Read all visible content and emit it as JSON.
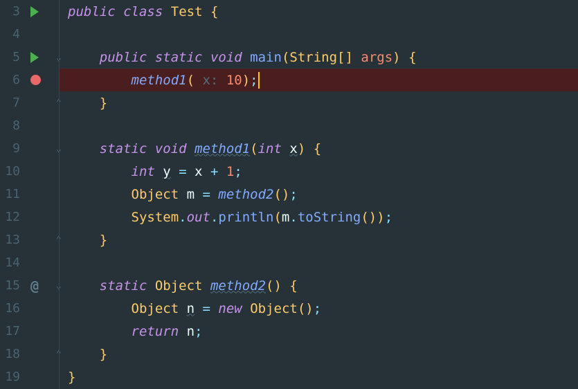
{
  "lines": [
    {
      "num": "3",
      "run": true,
      "breakpoint": false,
      "fold": false,
      "recursive": false,
      "highlighted": false
    },
    {
      "num": "4",
      "run": false,
      "breakpoint": false,
      "fold": false,
      "recursive": false,
      "highlighted": false
    },
    {
      "num": "5",
      "run": true,
      "breakpoint": false,
      "fold": true,
      "recursive": false,
      "highlighted": false
    },
    {
      "num": "6",
      "run": false,
      "breakpoint": true,
      "fold": false,
      "recursive": false,
      "highlighted": true
    },
    {
      "num": "7",
      "run": false,
      "breakpoint": false,
      "fold": true,
      "recursive": false,
      "highlighted": false
    },
    {
      "num": "8",
      "run": false,
      "breakpoint": false,
      "fold": false,
      "recursive": false,
      "highlighted": false
    },
    {
      "num": "9",
      "run": false,
      "breakpoint": false,
      "fold": true,
      "recursive": false,
      "highlighted": false
    },
    {
      "num": "10",
      "run": false,
      "breakpoint": false,
      "fold": false,
      "recursive": false,
      "highlighted": false
    },
    {
      "num": "11",
      "run": false,
      "breakpoint": false,
      "fold": false,
      "recursive": false,
      "highlighted": false
    },
    {
      "num": "12",
      "run": false,
      "breakpoint": false,
      "fold": false,
      "recursive": false,
      "highlighted": false
    },
    {
      "num": "13",
      "run": false,
      "breakpoint": false,
      "fold": true,
      "recursive": false,
      "highlighted": false
    },
    {
      "num": "14",
      "run": false,
      "breakpoint": false,
      "fold": false,
      "recursive": false,
      "highlighted": false
    },
    {
      "num": "15",
      "run": false,
      "breakpoint": false,
      "fold": true,
      "recursive": true,
      "highlighted": false
    },
    {
      "num": "16",
      "run": false,
      "breakpoint": false,
      "fold": false,
      "recursive": false,
      "highlighted": false
    },
    {
      "num": "17",
      "run": false,
      "breakpoint": false,
      "fold": false,
      "recursive": false,
      "highlighted": false
    },
    {
      "num": "18",
      "run": false,
      "breakpoint": false,
      "fold": true,
      "recursive": false,
      "highlighted": false
    },
    {
      "num": "19",
      "run": false,
      "breakpoint": false,
      "fold": false,
      "recursive": false,
      "highlighted": false
    }
  ],
  "tokens": {
    "public": "public",
    "class": "class",
    "static": "static",
    "void": "void",
    "int": "int",
    "new": "new",
    "return": "return",
    "Test": "Test",
    "main": "main",
    "String": "String",
    "args": "args",
    "method1": "method1",
    "method2": "method2",
    "x": "x",
    "y": "y",
    "m": "m",
    "n": "n",
    "Object": "Object",
    "System": "System",
    "out": "out",
    "println": "println",
    "toString": "toString",
    "hint_x": " x: ",
    "ten": "10",
    "one": "1",
    "plus": "+",
    "eq": "=",
    "dot": ".",
    "semi": ";",
    "comma": ",",
    "lparen": "(",
    "rparen": ")",
    "lbrace": "{",
    "rbrace": "}",
    "lbracket": "[",
    "rbracket": "]"
  }
}
